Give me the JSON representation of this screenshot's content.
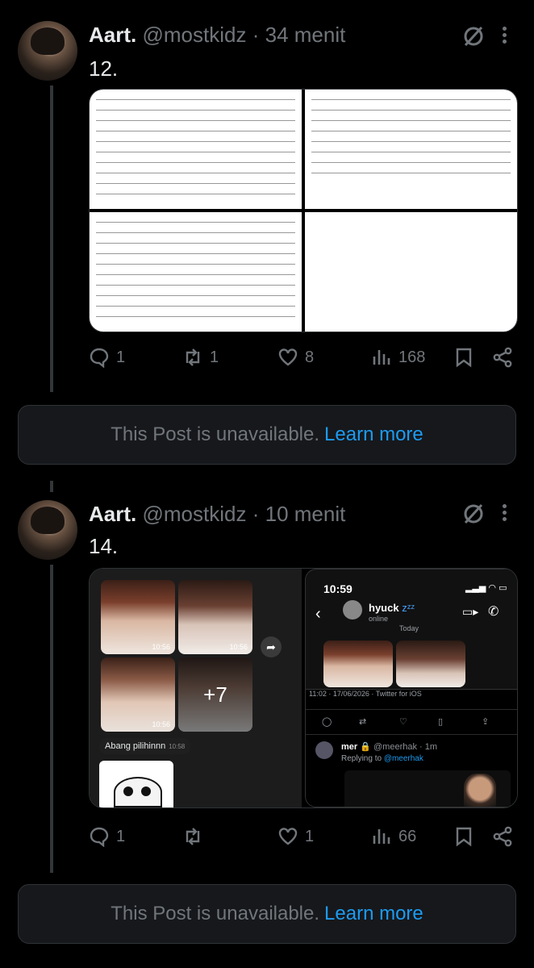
{
  "posts": [
    {
      "name": "Aart.",
      "handle": "@mostkidz",
      "dot": "·",
      "time": "34 menit",
      "text": "12.",
      "actions": {
        "reply": "1",
        "repost": "1",
        "like": "8",
        "views": "168"
      }
    },
    {
      "name": "Aart.",
      "handle": "@mostkidz",
      "dot": "·",
      "time": "10 menit",
      "text": "14.",
      "actions": {
        "reply": "1",
        "repost": "",
        "like": "1",
        "views": "66"
      },
      "media": {
        "chat": {
          "stamps": [
            "10:56",
            "10:56",
            "10:56"
          ],
          "more_count": "+7",
          "caption": "Abang pilihinnn",
          "caption_time": "10:58"
        },
        "phone": {
          "clock": "10:59",
          "contact": "hyuck",
          "zz": "zᶻᶻ",
          "status": "online",
          "day": "Today",
          "tweet_meta": "11:02 · 17/06/2026 · Twitter for iOS",
          "reply_user": "mer",
          "reply_handle": "@meerhak · 1m",
          "replying_to_prefix": "Replying to",
          "replying_to_handle": "@meerhak"
        }
      }
    }
  ],
  "unavailable": {
    "text": "This Post is unavailable.",
    "link": "Learn more"
  },
  "colors": {
    "background": "#000000",
    "muted": "#71767b",
    "link": "#1d9bf0",
    "card": "#16181c"
  }
}
